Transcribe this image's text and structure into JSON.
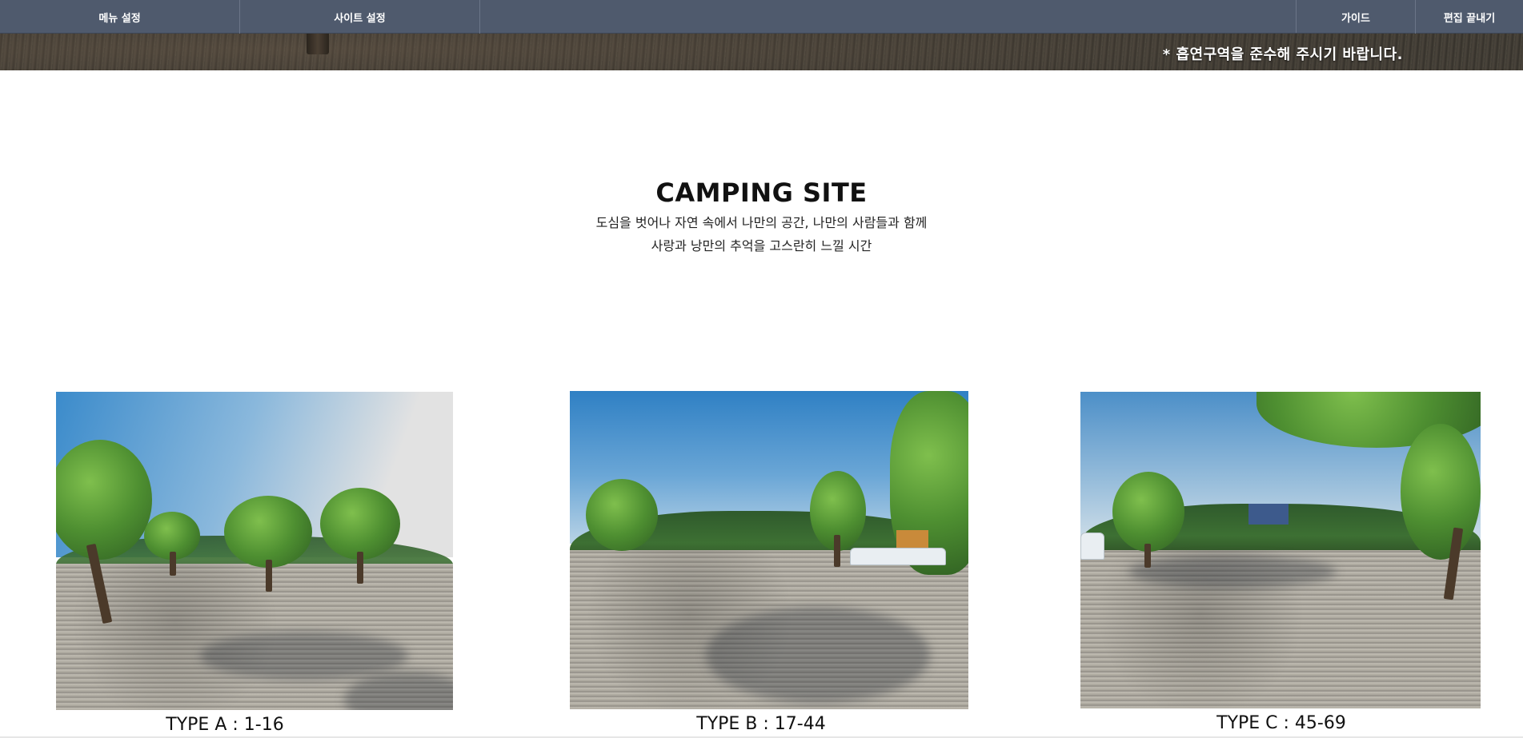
{
  "admin_bar": {
    "menu_settings": "메뉴 설정",
    "site_settings": "사이트 설정",
    "guide": "가이드",
    "finish_editing": "편집 끝내기",
    "bar_color": "#4f5a6d"
  },
  "hero": {
    "notice": "* 흡연구역을 준수해 주시기 바랍니다."
  },
  "section": {
    "title": "CAMPING SITE",
    "desc_line1": "도심을 벗어나 자연 속에서 나만의 공간, 나만의 사람들과 함께",
    "desc_line2": "사랑과 낭만의 추억을 고스란히 느낄 시간"
  },
  "sites": [
    {
      "label": "TYPE A : 1-16"
    },
    {
      "label": "TYPE B : 17-44"
    },
    {
      "label": "TYPE C : 45-69"
    }
  ]
}
